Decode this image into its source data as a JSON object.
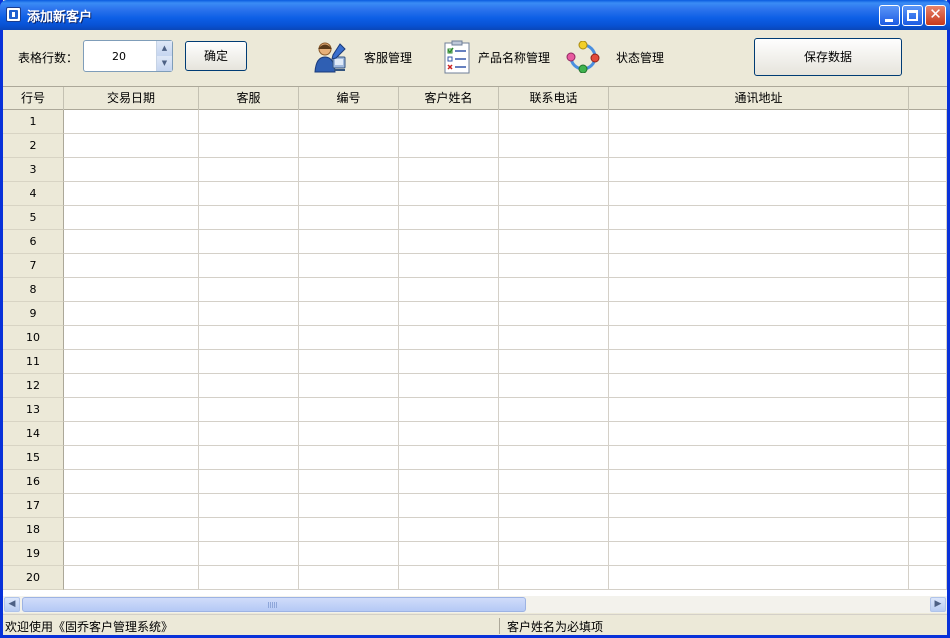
{
  "window": {
    "title": "添加新客户",
    "close_glyph": "✕"
  },
  "toolbar": {
    "rows_label": "表格行数：",
    "rows_value": "20",
    "spin_up": "▲",
    "spin_down": "▼",
    "ok_label": "确定",
    "cs_label": "客服管理",
    "cs_icon": "customer-service-icon",
    "product_label": "产品名称管理",
    "product_icon": "checklist-icon",
    "status_label": "状态管理",
    "status_icon": "status-cycle-icon",
    "save_label": "保存数据"
  },
  "grid": {
    "columns": [
      "行号",
      "交易日期",
      "客服",
      "编号",
      "客户姓名",
      "联系电话",
      "通讯地址"
    ],
    "rows": [
      "1",
      "2",
      "3",
      "4",
      "5",
      "6",
      "7",
      "8",
      "9",
      "10",
      "11",
      "12",
      "13",
      "14",
      "15",
      "16",
      "17",
      "18",
      "19",
      "20"
    ]
  },
  "scrollbar": {
    "left": "◀",
    "right": "▶"
  },
  "status": {
    "left": "欢迎使用《固乔客户管理系统》",
    "right": "客户姓名为必填项"
  },
  "colors": {
    "title_bar": "#0a5bdf",
    "window_face": "#ece9d8",
    "border": "#0831d9"
  }
}
